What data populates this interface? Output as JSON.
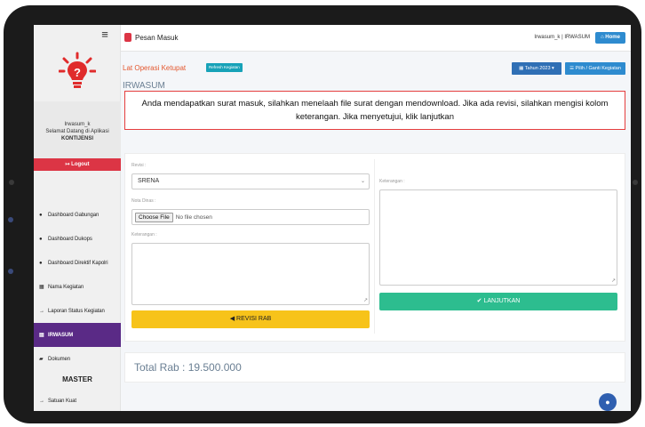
{
  "topbar": {
    "title": "Pesan Masuk",
    "user": "Irwasum_k | IRWASUM",
    "home_label": "⌂ Home",
    "menu_icon": "≡"
  },
  "sidebar": {
    "user_name": "Irwasum_k",
    "welcome": "Selamat Datang di Aplikasi",
    "org": "KONTIJENSI",
    "logout_label": "↦ Logout",
    "items": [
      {
        "label": "Dashboard Gabungan",
        "icon": "●"
      },
      {
        "label": "Dashboard Dukops",
        "icon": "●"
      },
      {
        "label": "Dashboard Direktif Kapolri",
        "icon": "●"
      },
      {
        "label": "Nama Kegiatan",
        "icon": "▦"
      },
      {
        "label": "Laporan Status Kegiatan",
        "icon": "→"
      },
      {
        "label": "IRWASUM",
        "icon": "▤"
      },
      {
        "label": "Dokumen",
        "icon": "▰"
      }
    ],
    "master_header": "MASTER",
    "master_items": [
      {
        "label": "Satuan Kuat",
        "icon": "→"
      }
    ]
  },
  "header": {
    "ops_title": "Lat Operasi Ketupat",
    "refresh_label": "Refresh Kegiatan",
    "year_label": "▦ Tahun 2023 ▾",
    "pilih_label": "☰ Pilih / Ganti Kegiatan",
    "section_title": "IRWASUM"
  },
  "notice": "Anda mendapatkan surat masuk, silahkan menelaah file surat dengan mendownload. Jika ada revisi, silahkan mengisi kolom keterangan. Jika menyetujui, klik lanjutkan",
  "form": {
    "revisi_label": "Revisi :",
    "revisi_value": "SRENA",
    "nota_label": "Nota Dinas :",
    "file_button": "Choose File",
    "file_status": "No file chosen",
    "keterangan_left_label": "Keterangan :",
    "keterangan_right_label": "Keterangan :",
    "revisi_button": "◀ REVISI RAB",
    "lanjut_button": "✔ LANJUTKAN"
  },
  "total_label": "Total Rab : 19.500.000",
  "colors": {
    "accent": "#5a2a86",
    "danger": "#dc3545",
    "warning": "#f7c31a",
    "success": "#2dbd8f",
    "info": "#2e8bcf"
  }
}
